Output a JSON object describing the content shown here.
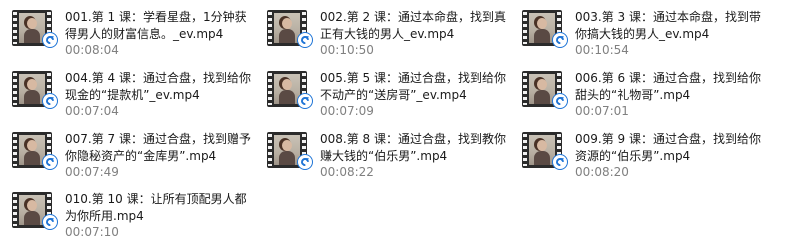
{
  "files": [
    {
      "name_line1": "001.第 1 课：学看星盘，1分钟获",
      "name_line2": "得男人的财富信息。_ev.mp4",
      "duration": "00:08:04"
    },
    {
      "name_line1": "002.第 2 课：通过本命盘，找到真",
      "name_line2": "正有大钱的男人_ev.mp4",
      "duration": "00:10:50"
    },
    {
      "name_line1": "003.第 3 课：通过本命盘，找到带",
      "name_line2": "你搞大钱的男人_ev.mp4",
      "duration": "00:10:54"
    },
    {
      "name_line1": "004.第 4 课：通过合盘，找到给你",
      "name_line2": "现金的“提款机”_ev.mp4",
      "duration": "00:07:04"
    },
    {
      "name_line1": "005.第 5 课：通过合盘，找到给你",
      "name_line2": "不动产的“送房哥”_ev.mp4",
      "duration": "00:07:09"
    },
    {
      "name_line1": "006.第 6 课：通过合盘，找到给你",
      "name_line2": "甜头的“礼物哥”.mp4",
      "duration": "00:07:01"
    },
    {
      "name_line1": "007.第 7 课：通过合盘，找到赠予",
      "name_line2": "你隐秘资产的“金库男”.mp4",
      "duration": "00:07:49"
    },
    {
      "name_line1": "008.第 8 课：通过合盘，找到教你",
      "name_line2": "赚大钱的“伯乐男”.mp4",
      "duration": "00:08:22"
    },
    {
      "name_line1": "009.第 9 课：通过合盘，找到给你",
      "name_line2": "资源的“伯乐男”.mp4",
      "duration": "00:08:20"
    },
    {
      "name_line1": "010.第 10 课：让所有顶配男人都",
      "name_line2": "为你所用.mp4",
      "duration": "00:07:10"
    }
  ],
  "icon": "video-file-icon",
  "badge_icon": "sync-badge-icon",
  "colors": {
    "badge": "#1e74d6",
    "duration_text": "#808080",
    "name_text": "#1a1a1a"
  }
}
